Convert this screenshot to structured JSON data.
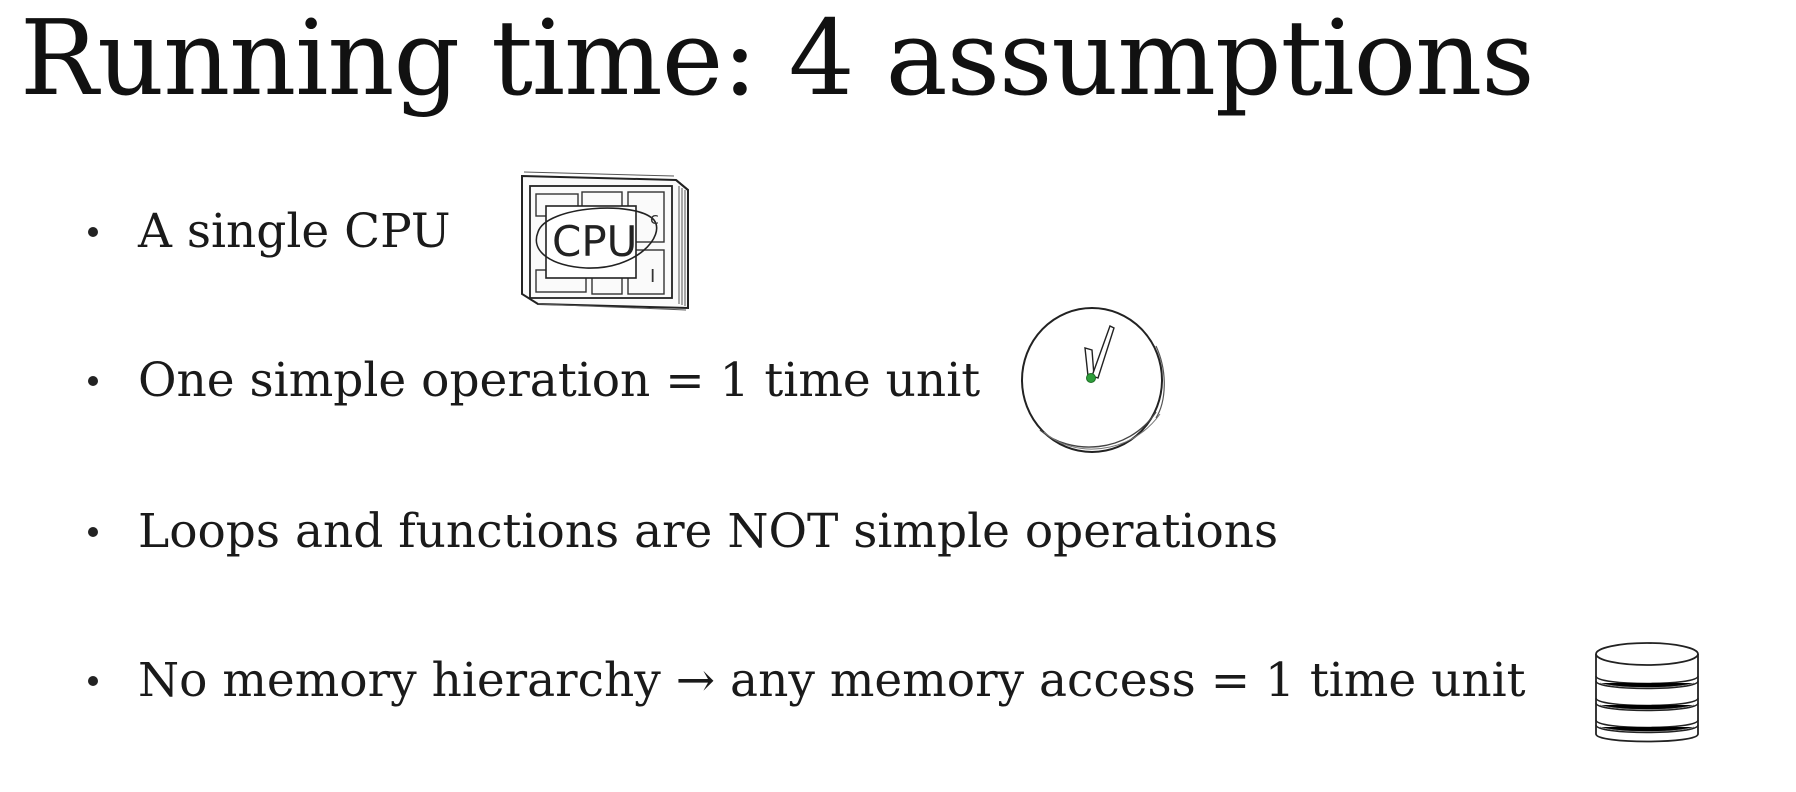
{
  "slide": {
    "title": "Running time: 4 assumptions",
    "bullets": [
      {
        "text": "A single CPU",
        "icon": "cpu-chip-icon"
      },
      {
        "text": "One simple operation = 1 time unit",
        "icon": "clock-icon"
      },
      {
        "text": "Loops and functions are NOT simple operations"
      },
      {
        "text": "No memory hierarchy → any memory access = 1 time unit",
        "icon": "database-stack-icon"
      }
    ],
    "cpu_label": "CPU",
    "cpu_side_labels": [
      "c",
      "I"
    ],
    "colors": {
      "text": "#1a1a1a",
      "clock_pivot": "#2e9e3a"
    }
  }
}
